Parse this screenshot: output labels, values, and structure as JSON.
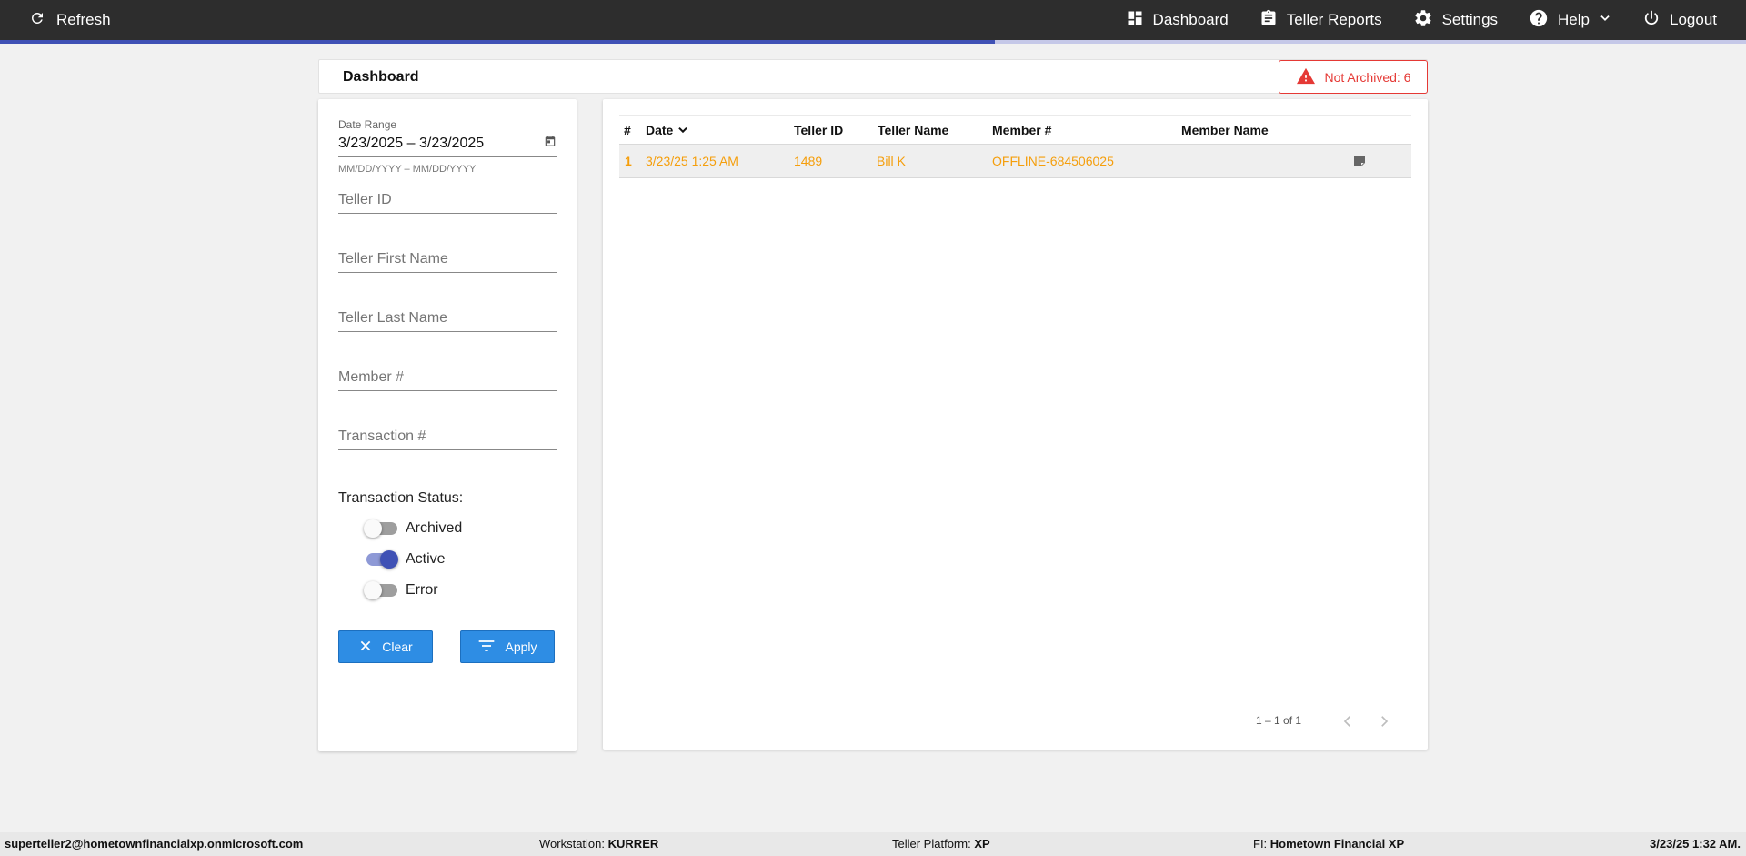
{
  "topbar": {
    "refresh_label": "Refresh",
    "nav": [
      {
        "label": "Dashboard",
        "icon": "dashboard-icon"
      },
      {
        "label": "Teller Reports",
        "icon": "clipboard-icon"
      },
      {
        "label": "Settings",
        "icon": "gear-icon"
      },
      {
        "label": "Help",
        "icon": "help-icon"
      },
      {
        "label": "Logout",
        "icon": "power-icon"
      }
    ],
    "progress": 0.57,
    "colors": {
      "bar": "#2d2d2d",
      "progress": "#3f51b5"
    }
  },
  "header": {
    "title": "Dashboard",
    "alert_label": "Not Archived: 6",
    "alert_color": "#e53935"
  },
  "filters": {
    "date_range": {
      "label": "Date Range",
      "value": "3/23/2025 – 3/23/2025",
      "hint": "MM/DD/YYYY – MM/DD/YYYY"
    },
    "teller_id_placeholder": "Teller ID",
    "teller_first_placeholder": "Teller First Name",
    "teller_last_placeholder": "Teller Last Name",
    "member_placeholder": "Member #",
    "transaction_placeholder": "Transaction #",
    "status_title": "Transaction Status:",
    "statuses": [
      {
        "label": "Archived",
        "on": false
      },
      {
        "label": "Active",
        "on": true
      },
      {
        "label": "Error",
        "on": false
      }
    ],
    "clear_label": "Clear",
    "apply_label": "Apply",
    "button_color": "#2e8de4"
  },
  "table": {
    "columns": [
      "#",
      "Date",
      "Teller ID",
      "Teller Name",
      "Member #",
      "Member Name"
    ],
    "sort_column": "Date",
    "rows": [
      {
        "num": "1",
        "date": "3/23/25 1:25 AM",
        "teller_id": "1489",
        "teller_name": "Bill K",
        "member": "OFFLINE-684506025",
        "member_name": "",
        "icon": "note-icon"
      }
    ],
    "row_color": "#f59e0b",
    "pagination": "1 – 1 of 1"
  },
  "footer": {
    "user": "superteller2@hometownfinancialxp.onmicrosoft.com",
    "workstation_label": "Workstation:",
    "workstation": "KURRER",
    "platform_label": "Teller Platform:",
    "platform": "XP",
    "fi_label": "FI:",
    "fi": "Hometown Financial XP",
    "datetime": "3/23/25 1:32 AM."
  }
}
